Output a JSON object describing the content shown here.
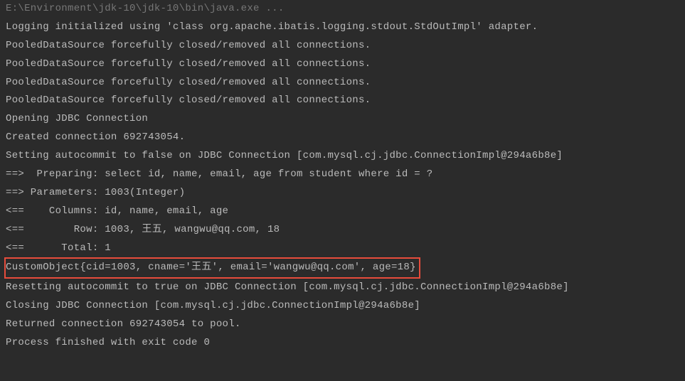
{
  "console": {
    "header": "E:\\Environment\\jdk-10\\jdk-10\\bin\\java.exe ...",
    "lines": [
      "Logging initialized using 'class org.apache.ibatis.logging.stdout.StdOutImpl' adapter.",
      "PooledDataSource forcefully closed/removed all connections.",
      "PooledDataSource forcefully closed/removed all connections.",
      "PooledDataSource forcefully closed/removed all connections.",
      "PooledDataSource forcefully closed/removed all connections.",
      "Opening JDBC Connection",
      "Created connection 692743054.",
      "Setting autocommit to false on JDBC Connection [com.mysql.cj.jdbc.ConnectionImpl@294a6b8e]",
      "==>  Preparing: select id, name, email, age from student where id = ?",
      "==> Parameters: 1003(Integer)",
      "<==    Columns: id, name, email, age",
      "<==        Row: 1003, 王五, wangwu@qq.com, 18",
      "<==      Total: 1"
    ],
    "highlighted": "CustomObject{cid=1003, cname='王五', email='wangwu@qq.com', age=18}",
    "linesAfter": [
      "Resetting autocommit to true on JDBC Connection [com.mysql.cj.jdbc.ConnectionImpl@294a6b8e]",
      "Closing JDBC Connection [com.mysql.cj.jdbc.ConnectionImpl@294a6b8e]",
      "Returned connection 692743054 to pool.",
      "",
      "Process finished with exit code 0"
    ]
  }
}
